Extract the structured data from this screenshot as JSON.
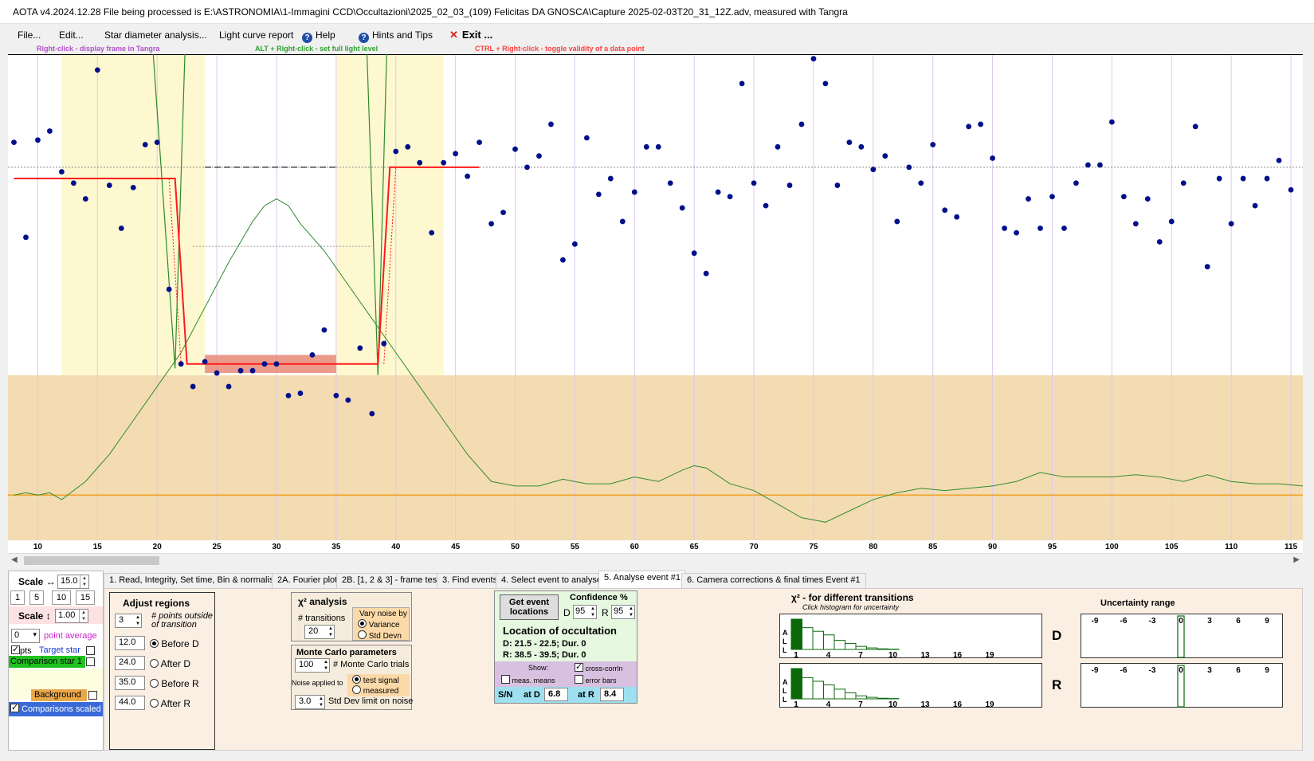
{
  "window": {
    "title": "AOTA v4.2024.12.28     File being processed is E:\\ASTRONOMIA\\1-Immagini CCD\\Occultazioni\\2025_02_03_(109) Felicitas DA GNOSCA\\Capture 2025-02-03T20_31_12Z.adv, measured with Tangra"
  },
  "menu": {
    "file": "File...",
    "edit": "Edit...",
    "star_diameter": "Star diameter analysis...",
    "light_curve": "Light curve report",
    "help": "Help",
    "hints": "Hints and Tips",
    "exit": "Exit ..."
  },
  "hints": {
    "right_click": "Right-click  -  display frame in Tangra",
    "alt_right_click": "ALT + Right-click  -  set full light level",
    "ctrl_right_click": "CTRL + Right-click  -  toggle validity of a data point",
    "colors": {
      "right_click": "#b04ec8",
      "alt_right_click": "#2ea02e",
      "ctrl_right_click": "#ff4040"
    }
  },
  "chart_data": {
    "type": "scatter",
    "xlim": [
      7.5,
      116
    ],
    "ylim": [
      -0.78,
      1.37
    ],
    "x_ticks": [
      10,
      15,
      20,
      25,
      30,
      35,
      40,
      45,
      50,
      55,
      60,
      65,
      70,
      75,
      80,
      85,
      90,
      95,
      100,
      105,
      110,
      115
    ],
    "points": [
      [
        8,
        0.98
      ],
      [
        9,
        0.56
      ],
      [
        10,
        0.99
      ],
      [
        11,
        1.03
      ],
      [
        12,
        0.85
      ],
      [
        13,
        0.8
      ],
      [
        14,
        0.73
      ],
      [
        15,
        1.3
      ],
      [
        16,
        0.79
      ],
      [
        17,
        0.6
      ],
      [
        18,
        0.78
      ],
      [
        19,
        0.97
      ],
      [
        20,
        0.98
      ],
      [
        21,
        0.33
      ],
      [
        22,
        0.0
      ],
      [
        23,
        -0.1
      ],
      [
        24,
        0.01
      ],
      [
        25,
        -0.04
      ],
      [
        26,
        -0.1
      ],
      [
        27,
        -0.03
      ],
      [
        28,
        -0.03
      ],
      [
        29,
        0.0
      ],
      [
        30,
        0.0
      ],
      [
        31,
        -0.14
      ],
      [
        32,
        -0.13
      ],
      [
        33,
        0.04
      ],
      [
        34,
        0.15
      ],
      [
        35,
        -0.14
      ],
      [
        36,
        -0.16
      ],
      [
        37,
        0.07
      ],
      [
        38,
        -0.22
      ],
      [
        39,
        0.09
      ],
      [
        40,
        0.94
      ],
      [
        41,
        0.96
      ],
      [
        42,
        0.89
      ],
      [
        43,
        0.58
      ],
      [
        44,
        0.89
      ],
      [
        45,
        0.93
      ],
      [
        46,
        0.83
      ],
      [
        47,
        0.98
      ],
      [
        48,
        0.62
      ],
      [
        49,
        0.67
      ],
      [
        50,
        0.95
      ],
      [
        51,
        0.87
      ],
      [
        52,
        0.92
      ],
      [
        53,
        1.06
      ],
      [
        54,
        0.46
      ],
      [
        55,
        0.53
      ],
      [
        56,
        1.0
      ],
      [
        57,
        0.75
      ],
      [
        58,
        0.82
      ],
      [
        59,
        0.63
      ],
      [
        60,
        0.76
      ],
      [
        61,
        0.96
      ],
      [
        62,
        0.96
      ],
      [
        63,
        0.8
      ],
      [
        64,
        0.69
      ],
      [
        65,
        0.49
      ],
      [
        66,
        0.4
      ],
      [
        67,
        0.76
      ],
      [
        68,
        0.74
      ],
      [
        69,
        1.24
      ],
      [
        70,
        0.8
      ],
      [
        71,
        0.7
      ],
      [
        72,
        0.96
      ],
      [
        73,
        0.79
      ],
      [
        74,
        1.06
      ],
      [
        75,
        1.35
      ],
      [
        76,
        1.24
      ],
      [
        77,
        0.79
      ],
      [
        78,
        0.98
      ],
      [
        79,
        0.96
      ],
      [
        80,
        0.86
      ],
      [
        81,
        0.92
      ],
      [
        82,
        0.63
      ],
      [
        83,
        0.87
      ],
      [
        84,
        0.8
      ],
      [
        85,
        0.97
      ],
      [
        86,
        0.68
      ],
      [
        87,
        0.65
      ],
      [
        88,
        1.05
      ],
      [
        89,
        1.06
      ],
      [
        90,
        0.91
      ],
      [
        91,
        0.6
      ],
      [
        92,
        0.58
      ],
      [
        93,
        0.73
      ],
      [
        94,
        0.6
      ],
      [
        95,
        0.74
      ],
      [
        96,
        0.6
      ],
      [
        97,
        0.8
      ],
      [
        98,
        0.88
      ],
      [
        99,
        0.88
      ],
      [
        100,
        1.07
      ],
      [
        101,
        0.74
      ],
      [
        102,
        0.62
      ],
      [
        103,
        0.73
      ],
      [
        104,
        0.54
      ],
      [
        105,
        0.63
      ],
      [
        106,
        0.8
      ],
      [
        107,
        1.05
      ],
      [
        108,
        0.43
      ],
      [
        109,
        0.82
      ],
      [
        110,
        0.62
      ],
      [
        111,
        0.82
      ],
      [
        112,
        0.7
      ],
      [
        113,
        0.82
      ],
      [
        114,
        0.9
      ],
      [
        115,
        0.77
      ]
    ],
    "shaded_regions": [
      [
        12.0,
        24.0
      ],
      [
        35.0,
        44.0
      ]
    ],
    "baseline_level": 0.87,
    "occulted_level": 0.0,
    "model_fit": [
      [
        8,
        0.82
      ],
      [
        21.5,
        0.82
      ],
      [
        22.5,
        0.0
      ],
      [
        38.5,
        0.0
      ],
      [
        39.5,
        0.87
      ],
      [
        47,
        0.87
      ]
    ]
  },
  "bottom_tabs": {
    "items": [
      "1. Read, Integrity, Set time, Bin & normalise",
      "2A. Fourier plot",
      "2B. [1, 2 & 3] - frame test",
      "3. Find events",
      "4. Select event to analyse",
      "5. Analyse event #1",
      "6. Camera corrections & final times Event #1"
    ],
    "active_index": 5
  },
  "left_panel": {
    "scale_h_label": "Scale ↔",
    "scale_h_value": "15.0",
    "scale_buttons": [
      "1",
      "5",
      "10",
      "15"
    ],
    "scale_v_label": "Scale ↕",
    "scale_v_value": "1.00",
    "point_avg_value": "0",
    "point_avg_label": "point average",
    "pts_label": "pts",
    "target_star": "Target star",
    "comparison_star": "Comparison star 1",
    "background": "Background",
    "comparisons_scaled": "Comparisons scaled"
  },
  "adjust_regions": {
    "title": "Adjust regions",
    "points_value": "3",
    "points_label": "# points outside of transition",
    "rows": [
      {
        "value": "12.0",
        "label": "Before D",
        "selected": true
      },
      {
        "value": "24.0",
        "label": "After D",
        "selected": false
      },
      {
        "value": "35.0",
        "label": "Before R",
        "selected": false
      },
      {
        "value": "44.0",
        "label": "After R",
        "selected": false
      }
    ]
  },
  "chi2": {
    "title": "χ² analysis",
    "transitions_label": "# transitions",
    "transitions_value": "20",
    "vary_label": "Vary noise by",
    "variance": "Variance",
    "std_devn": "Std Devn"
  },
  "monte_carlo": {
    "title": "Monte Carlo parameters",
    "trials_value": "100",
    "trials_label": "# Monte Carlo trials",
    "noise_label": "Noise applied to",
    "test_signal": "test signal",
    "measured": "measured",
    "std_value": "3.0",
    "std_label": "Std Dev limit on noise"
  },
  "location": {
    "get_events": "Get event locations",
    "confidence": "Confidence %",
    "d_label": "D",
    "d_value": "95",
    "r_label": "R",
    "r_value": "95",
    "heading": "Location of occultation",
    "d_line": "D: 21.5 - 22.5; Dur. 0",
    "r_line": "R: 38.5 - 39.5; Dur. 0",
    "show": "Show:",
    "cross_corr": "cross-corrln",
    "meas_means": "meas. means",
    "error_bars": "error bars",
    "sn": "S/N",
    "at_d": "at D",
    "sn_d": "6.8",
    "at_r": "at R",
    "sn_r": "8.4"
  },
  "chi2_hist": {
    "title": "χ² - for different transitions",
    "subtitle": "Click histogram for uncertainty",
    "ticks": [
      "1",
      "4",
      "7",
      "10",
      "13",
      "16",
      "19"
    ],
    "all_label": "A L L",
    "d_label": "D",
    "r_label": "R",
    "bars_d": [
      1.0,
      0.72,
      0.6,
      0.48,
      0.3,
      0.2,
      0.1,
      0.05,
      0.02,
      0.01
    ],
    "bars_r": [
      1.0,
      0.7,
      0.58,
      0.46,
      0.32,
      0.2,
      0.1,
      0.05,
      0.02,
      0.01
    ]
  },
  "uncertainty": {
    "title": "Uncertainty range",
    "ticks": [
      "-9",
      "-6",
      "-3",
      "0",
      "3",
      "6",
      "9"
    ]
  }
}
